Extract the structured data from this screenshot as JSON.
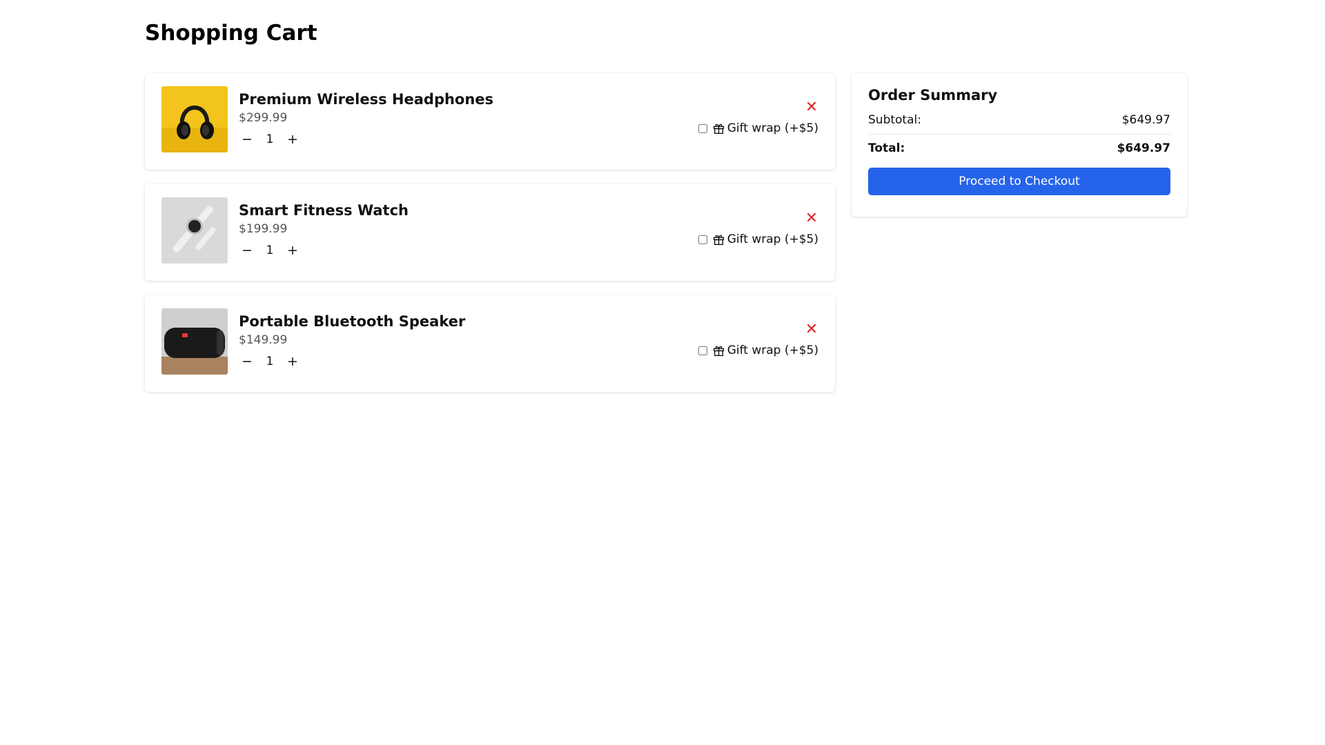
{
  "page": {
    "title": "Shopping Cart"
  },
  "cart": {
    "items": [
      {
        "name": "Premium Wireless Headphones",
        "price": "$299.99",
        "quantity": "1",
        "gift_wrap_label": "Gift wrap (+$5)",
        "gift_wrap_checked": false,
        "image": "headphones-photo"
      },
      {
        "name": "Smart Fitness Watch",
        "price": "$199.99",
        "quantity": "1",
        "gift_wrap_label": "Gift wrap (+$5)",
        "gift_wrap_checked": false,
        "image": "smartwatch-photo"
      },
      {
        "name": "Portable Bluetooth Speaker",
        "price": "$149.99",
        "quantity": "1",
        "gift_wrap_label": "Gift wrap (+$5)",
        "gift_wrap_checked": false,
        "image": "speaker-photo"
      }
    ],
    "decrement_glyph": "−",
    "increment_glyph": "+",
    "remove_glyph": "✕"
  },
  "summary": {
    "title": "Order Summary",
    "subtotal_label": "Subtotal:",
    "subtotal_value": "$649.97",
    "total_label": "Total:",
    "total_value": "$649.97",
    "checkout_label": "Proceed to Checkout"
  },
  "colors": {
    "accent": "#2563eb",
    "remove": "#dc2626",
    "price": "#555555"
  }
}
